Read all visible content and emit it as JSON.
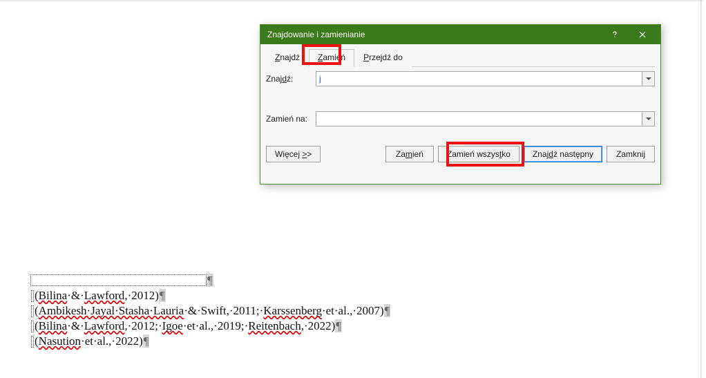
{
  "dialog": {
    "title": "Znajdowanie i zamienianie",
    "tabs": {
      "find": "Znajdź",
      "replace": "Zamień",
      "goto": "Przejdź do"
    },
    "find_label": "Znajdź:",
    "find_value": "j",
    "replace_label": "Zamień na:",
    "replace_value": "",
    "buttons": {
      "more": "Więcej >>",
      "replace": "Zamień",
      "replace_all": "Zamień wszystko",
      "find_next": "Znajdź następny",
      "close": "Zamknij"
    }
  },
  "doc": {
    "l1_a": "(",
    "l1_b": "Bilina",
    "l1_c": "·&·",
    "l1_d": "Lawford",
    "l1_e": ",·2012)¶",
    "l2_a": "(",
    "l2_b": "Ambikesh·Jayal·Stasha·Lauria",
    "l2_c": "·&·Swift,·2011;·",
    "l2_d": "Karssenberg",
    "l2_e": "·et·al.,·2007)¶",
    "l3_a": "(",
    "l3_b": "Bilina",
    "l3_c": "·&·",
    "l3_d": "Lawford",
    "l3_e": ",·2012;·",
    "l3_f": "Igoe",
    "l3_g": "·et·al.,·2019;·",
    "l3_h": "Reitenbach",
    "l3_i": ",·2022)¶",
    "l4_a": "(",
    "l4_b": "Nasution",
    "l4_c": "·et·al.,·2022)¶",
    "pilcrow": "¶"
  }
}
